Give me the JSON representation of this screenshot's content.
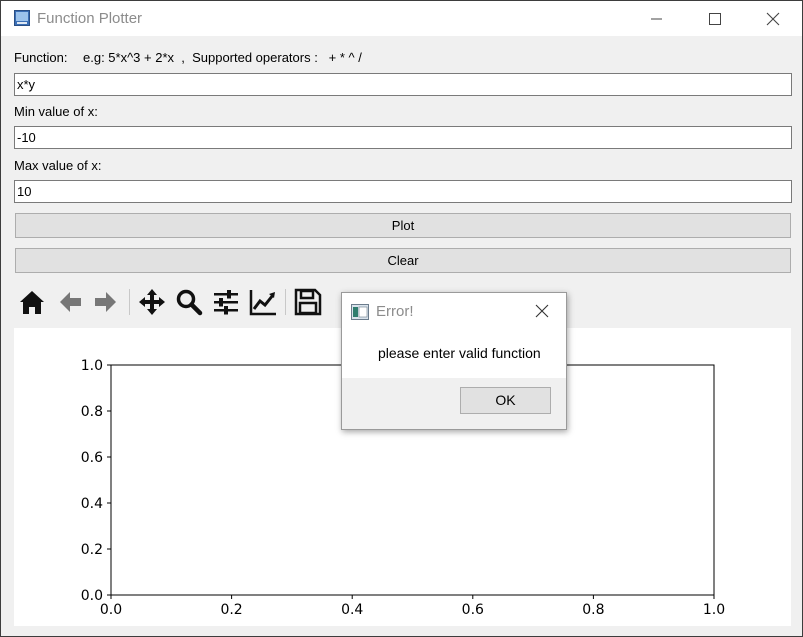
{
  "window": {
    "title": "Function Plotter",
    "controls": [
      "minimize-icon",
      "maximize-icon",
      "close-icon"
    ]
  },
  "form": {
    "function_label": "Function:",
    "function_hint": "e.g: 5*x^3 + 2*x  ,  Supported operators :   + * ^ /",
    "function_value": "x*y",
    "min_label": "Min value of x:",
    "min_value": "-10",
    "max_label": "Max value of x:",
    "max_value": "10",
    "plot_button": "Plot",
    "clear_button": "Clear"
  },
  "toolbar": {
    "icons": [
      "home-icon",
      "back-icon",
      "forward-icon",
      "pan-icon",
      "zoom-icon",
      "subplots-icon",
      "customize-icon",
      "save-icon"
    ]
  },
  "chart_data": {
    "type": "line",
    "series": [],
    "xlim": [
      0.0,
      1.0
    ],
    "ylim": [
      0.0,
      1.0
    ],
    "xticks": [
      "0.0",
      "0.2",
      "0.4",
      "0.6",
      "0.8",
      "1.0"
    ],
    "yticks": [
      "0.0",
      "0.2",
      "0.4",
      "0.6",
      "0.8",
      "1.0"
    ],
    "title": "",
    "xlabel": "",
    "ylabel": "",
    "grid": false
  },
  "dialog": {
    "title": "Error!",
    "message": "please enter valid function",
    "ok_button": "OK"
  }
}
